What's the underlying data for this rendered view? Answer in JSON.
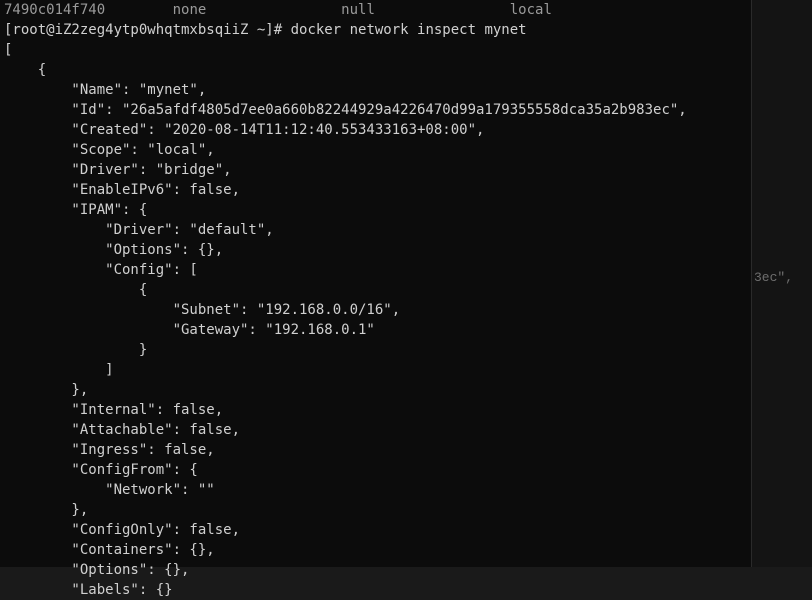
{
  "topbar": {
    "frag1": "7490c014f740",
    "frag2": "none",
    "frag3": "null",
    "frag4": "local"
  },
  "prompt": {
    "user_host": "[root@iZ2zeg4ytp0whqtmxbsqiiZ ~]#",
    "command": "docker network inspect mynet"
  },
  "output_lines": [
    "[",
    "    {",
    "        \"Name\": \"mynet\",",
    "        \"Id\": \"26a5afdf4805d7ee0a660b82244929a4226470d99a179355558dca35a2b983ec\",",
    "        \"Created\": \"2020-08-14T11:12:40.553433163+08:00\",",
    "        \"Scope\": \"local\",",
    "        \"Driver\": \"bridge\",",
    "        \"EnableIPv6\": false,",
    "        \"IPAM\": {",
    "            \"Driver\": \"default\",",
    "            \"Options\": {},",
    "            \"Config\": [",
    "                {",
    "                    \"Subnet\": \"192.168.0.0/16\",",
    "                    \"Gateway\": \"192.168.0.1\"",
    "                }",
    "            ]",
    "        },",
    "        \"Internal\": false,",
    "        \"Attachable\": false,",
    "        \"Ingress\": false,",
    "        \"ConfigFrom\": {",
    "            \"Network\": \"\"",
    "        },",
    "        \"ConfigOnly\": false,",
    "        \"Containers\": {},",
    "        \"Options\": {},",
    "        \"Labels\": {}"
  ],
  "behind_fragment": "3ec\","
}
